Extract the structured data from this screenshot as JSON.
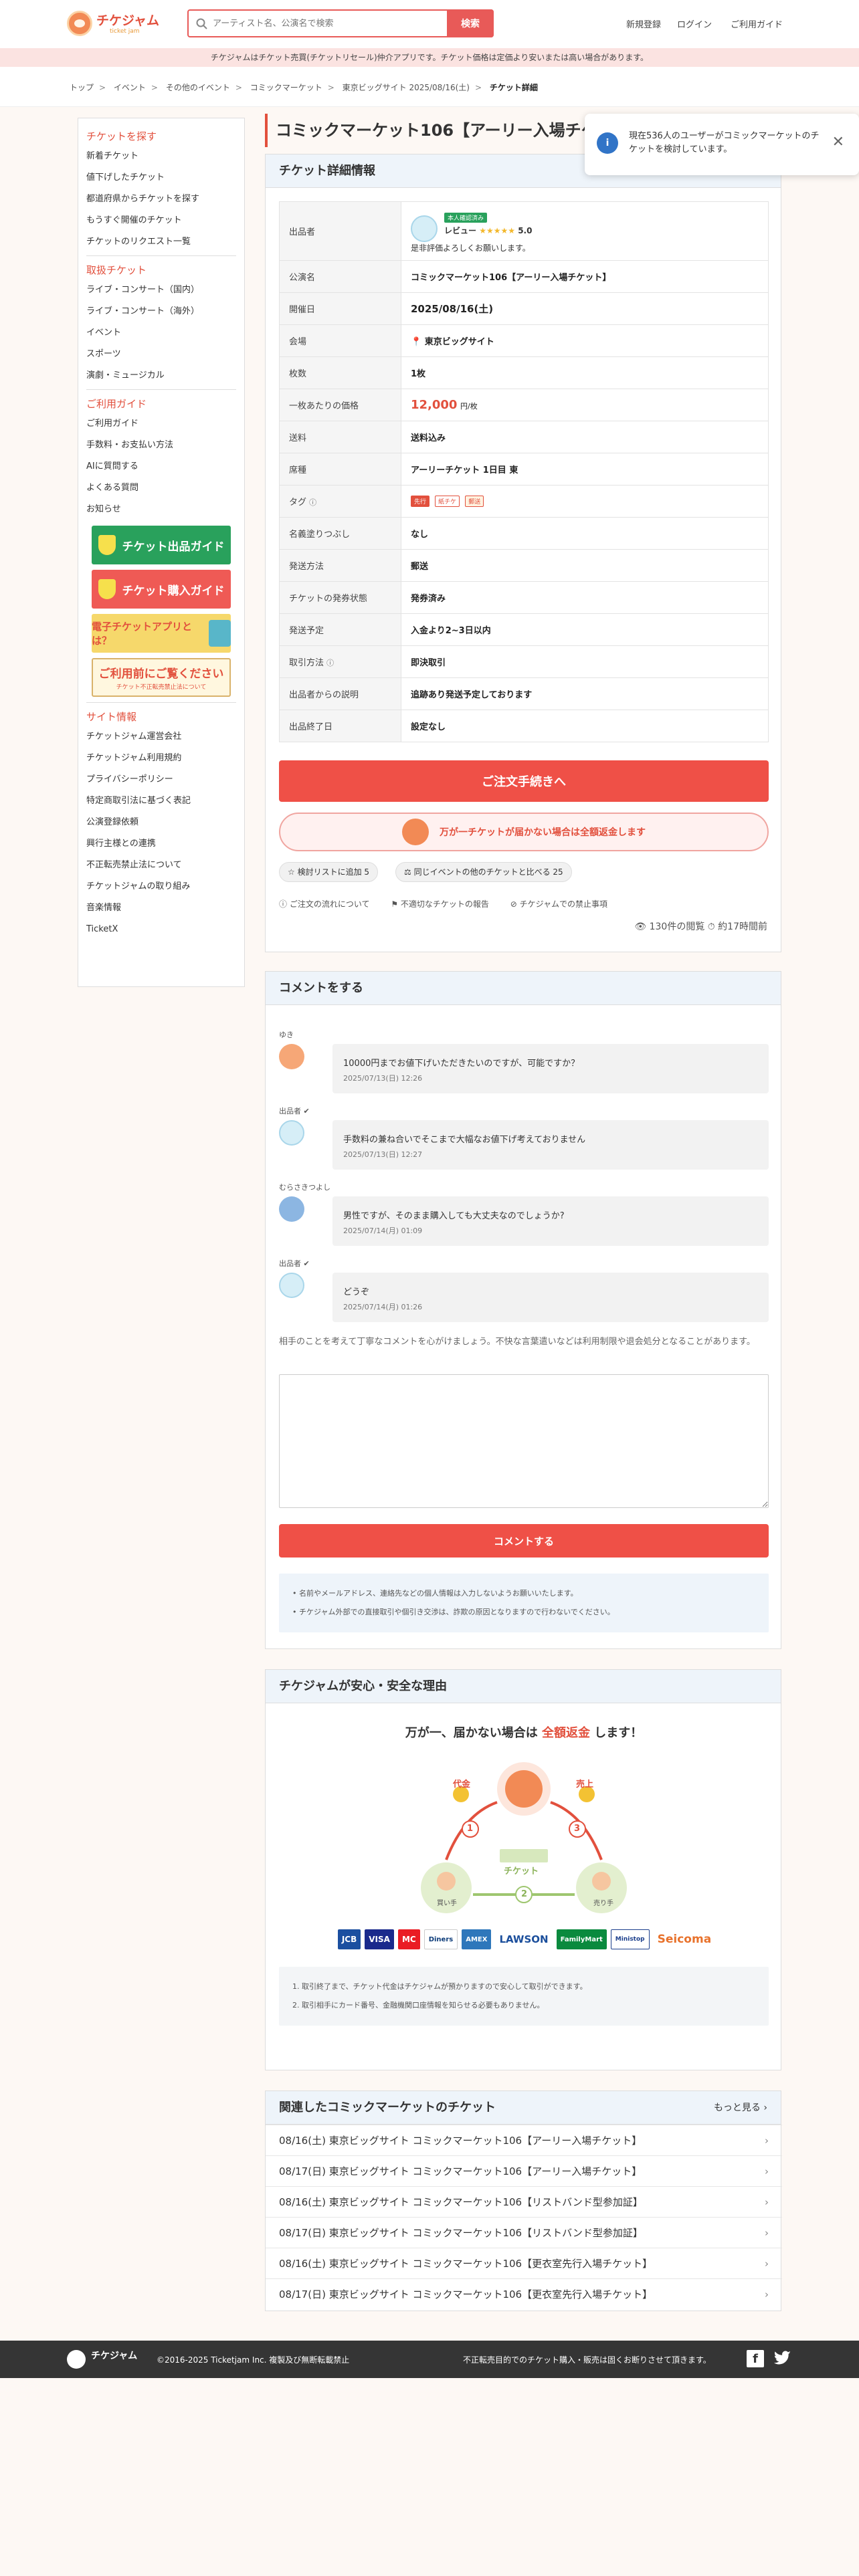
{
  "header": {
    "logo_text": "チケジャム",
    "logo_sub": "ticket jam",
    "search_placeholder": "アーティスト名、公演名で検索",
    "search_button": "検索",
    "nav": [
      "新規登録",
      "ログイン",
      "ご利用ガイド"
    ]
  },
  "notice": "チケジャムはチケット売買(チケットリセール)仲介アプリです。チケット価格は定価より安いまたは高い場合があります。",
  "breadcrumb": [
    "トップ",
    "イベント",
    "その他のイベント",
    "コミックマーケット",
    "東京ビッグサイト 2025/08/16(土)",
    "チケット詳細"
  ],
  "sidebar": {
    "sections": [
      {
        "title": "チケットを探す",
        "items": [
          "新着チケット",
          "値下げしたチケット",
          "都道府県からチケットを探す",
          "もうすぐ開催のチケット",
          "チケットのリクエスト一覧"
        ]
      },
      {
        "title": "取扱チケット",
        "items": [
          "ライブ・コンサート（国内）",
          "ライブ・コンサート（海外）",
          "イベント",
          "スポーツ",
          "演劇・ミュージカル"
        ]
      },
      {
        "title": "ご利用ガイド",
        "items": [
          "ご利用ガイド",
          "手数料・お支払い方法",
          "AIに質問する",
          "よくある質問",
          "お知らせ"
        ]
      }
    ],
    "banners": [
      "チケット出品ガイド",
      "チケット購入ガイド",
      "電子チケットアプリとは？",
      "ご利用前にご覧ください"
    ],
    "banner_sub": "チケット不正転売禁止法について",
    "site_title": "サイト情報",
    "site_items": [
      "チケットジャム運営会社",
      "チケットジャム利用規約",
      "プライバシーポリシー",
      "特定商取引法に基づく表記",
      "公演登録依頼",
      "興行主様との連携",
      "不正転売禁止法について",
      "チケットジャムの取り組み",
      "音楽情報",
      "TicketX"
    ]
  },
  "page_title": "コミックマーケット106【アーリー入場チケット】",
  "toast": {
    "message": "現在536人のユーザーがコミックマーケットのチケットを検討しています。"
  },
  "detail": {
    "heading": "チケット詳細情報",
    "seller_badge": "本人確認済み",
    "seller_rating_label": "レビュー",
    "seller_rating": "5.0",
    "seller_note": "是非評価よろしくお願いします。",
    "rows": [
      {
        "k": "出品者",
        "v": ""
      },
      {
        "k": "公演名",
        "v": "コミックマーケット106【アーリー入場チケット】"
      },
      {
        "k": "開催日",
        "v": "2025/08/16(土)"
      },
      {
        "k": "会場",
        "v": "東京ビッグサイト"
      },
      {
        "k": "枚数",
        "v": "1枚"
      },
      {
        "k": "一枚あたりの価格",
        "v": "12,000"
      },
      {
        "k": "送料",
        "v": "送料込み"
      },
      {
        "k": "席種",
        "v": "アーリーチケット 1日目 東"
      },
      {
        "k": "タグ",
        "v": ""
      },
      {
        "k": "名義塗りつぶし",
        "v": "なし"
      },
      {
        "k": "発送方法",
        "v": "郵送"
      },
      {
        "k": "チケットの発券状態",
        "v": "発券済み"
      },
      {
        "k": "発送予定",
        "v": "入金より2~3日以内"
      },
      {
        "k": "取引方法",
        "v": "即決取引"
      },
      {
        "k": "出品者からの説明",
        "v": "追跡あり発送予定しております"
      },
      {
        "k": "出品終了日",
        "v": "設定なし"
      }
    ],
    "price_unit": "円/枚",
    "tags": [
      "先行",
      "紙チケ",
      "郵送"
    ],
    "order_button": "ご注文手続きへ",
    "guarantee": "万が一チケットが届かない場合は全額返金します",
    "wishlist": "検討リストに追加 5",
    "compare": "同じイベントの他のチケットと比べる 25",
    "links": [
      "ご注文の流れについて",
      "不適切なチケットの報告",
      "チケジャムでの禁止事項"
    ],
    "views": "130件の閲覧",
    "time_ago": "約17時間前"
  },
  "comments": {
    "heading": "コメントをする",
    "items": [
      {
        "name": "ゆき",
        "text": "10000円までお値下げいただきたいのですが、可能ですか？",
        "date": "2025/07/13(日) 12:26"
      },
      {
        "name": "出品者",
        "text": "手数料の兼ね合いでそこまで大幅なお値下げ考えておりません",
        "date": "2025/07/13(日) 12:27"
      },
      {
        "name": "むらさきつよし",
        "text": "男性ですが、そのまま購入しても大丈夫なのでしょうか?",
        "date": "2025/07/14(月) 01:09"
      },
      {
        "name": "出品者",
        "text": "どうぞ",
        "date": "2025/07/14(月) 01:26"
      }
    ],
    "hint": "相手のことを考えて丁寧なコメントを心がけましょう。不快な言葉遣いなどは利用制限や退会処分となることがあります。",
    "submit": "コメントする",
    "notes": [
      "名前やメールアドレス、連絡先などの個人情報は入力しないようお願いいたします。",
      "チケジャム外部での直接取引や個引き交渉は、詐欺の原因となりますので行わないでください。"
    ]
  },
  "safety": {
    "heading": "チケジャムが安心・安全な理由",
    "lead_a": "万が一、届かない場合は",
    "lead_b": "全額返金",
    "lead_c": "します！",
    "labels": [
      "代金",
      "売上",
      "チケット",
      "買い手",
      "売り手"
    ],
    "steps": [
      "1",
      "2",
      "3"
    ],
    "payments": [
      "JCB",
      "VISA",
      "MC",
      "Diners",
      "AMEX",
      "LAWSON",
      "FamilyMart",
      "Ministop",
      "Seicoma"
    ],
    "notes": [
      "取引終了まで、チケット代金はチケジャムが預かりますので安心して取引ができます。",
      "取引相手にカード番号、金融機関口座情報を知らせる必要もありません。"
    ]
  },
  "related": {
    "heading": "関連したコミックマーケットのチケット",
    "more": "もっと見る",
    "items": [
      "08/16(土) 東京ビッグサイト コミックマーケット106【アーリー入場チケット】",
      "08/17(日) 東京ビッグサイト コミックマーケット106【アーリー入場チケット】",
      "08/16(土) 東京ビッグサイト コミックマーケット106【リストバンド型参加証】",
      "08/17(日) 東京ビッグサイト コミックマーケット106【リストバンド型参加証】",
      "08/16(土) 東京ビッグサイト コミックマーケット106【更衣室先行入場チケット】",
      "08/17(日) 東京ビッグサイト コミックマーケット106【更衣室先行入場チケット】"
    ]
  },
  "footer": {
    "copyright": "©2016-2025 Ticketjam Inc. 複製及び無断転載禁止",
    "warning": "不正転売目的でのチケット購入・販売は固くお断りさせて頂きます。"
  },
  "colors": {
    "accent": "#e2503d",
    "link": "#2f6fb7",
    "panel": "#eef4fa"
  }
}
